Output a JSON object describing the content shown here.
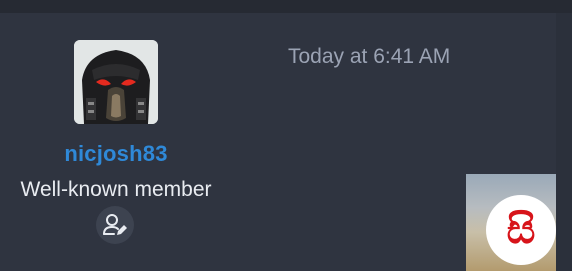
{
  "post": {
    "author": {
      "username": "nicjosh83",
      "title": "Well-known member",
      "avatar_icon": "predator-mask-avatar",
      "badge_icon": "user-edit-icon"
    },
    "timestamp": "Today at 6:41 AM"
  },
  "overlay": {
    "logo_text": "සි"
  },
  "colors": {
    "background": "#2f3440",
    "username": "#2f89d8",
    "title": "#e9ecf1",
    "timestamp": "#9ba3b4",
    "logo_red": "#d7141a"
  }
}
